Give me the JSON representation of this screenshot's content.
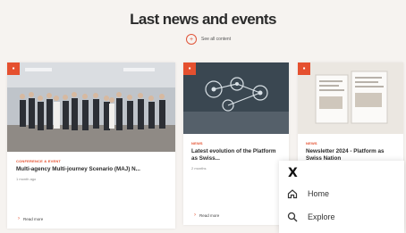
{
  "section": {
    "title": "Last news and events",
    "see_all_label": "See all content",
    "see_all_icon": "plus-icon"
  },
  "cards": [
    {
      "category": "Conference & Event",
      "title": "Multi-agency Multi-journey Scenario (MAJ) N...",
      "date": "1 month ago",
      "read_more": "Read more"
    },
    {
      "category": "News",
      "title": "Latest evolution of the Platform as Swiss...",
      "date": "2 months",
      "read_more": "Read more"
    },
    {
      "category": "News",
      "title": "Newsletter 2024 - Platform as Swiss Nation",
      "date": "",
      "read_more": ""
    }
  ],
  "popup_menu": {
    "logo": "X",
    "items": [
      {
        "label": "Home",
        "icon": "home-icon"
      },
      {
        "label": "Explore",
        "icon": "search-icon"
      }
    ]
  },
  "colors": {
    "accent": "#e5502f",
    "background": "#f6f3f0"
  }
}
